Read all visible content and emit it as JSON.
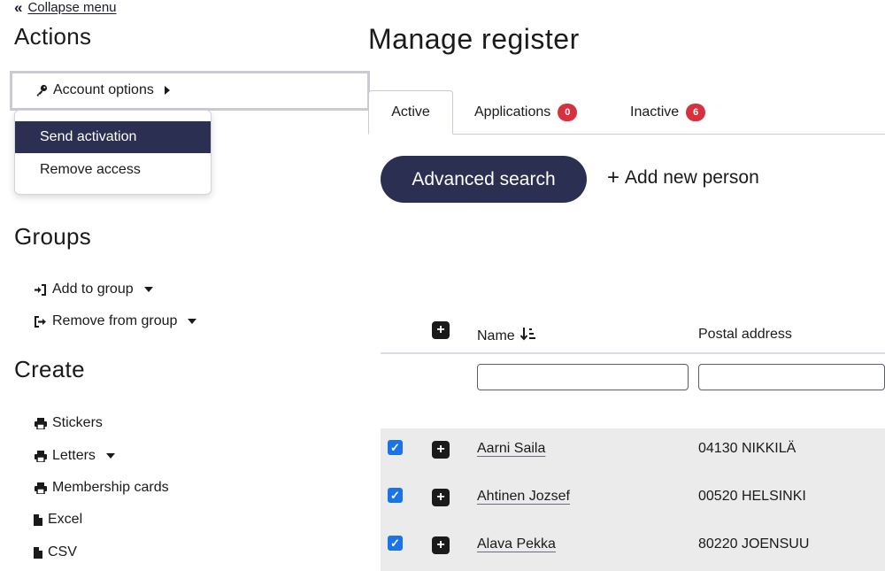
{
  "sidebar": {
    "collapse_label": "Collapse menu",
    "actions_heading": "Actions",
    "account_options_label": "Account options",
    "dropdown_items": [
      "Send activation",
      "Remove access"
    ],
    "groups_heading": "Groups",
    "groups_links": [
      "Add to group",
      "Remove from group"
    ],
    "create_heading": "Create",
    "create_links": [
      "Stickers",
      "Letters",
      "Membership cards",
      "Excel",
      "CSV"
    ]
  },
  "main": {
    "title": "Manage register",
    "tabs": [
      {
        "label": "Active",
        "count": ""
      },
      {
        "label": "Applications",
        "count": "0"
      },
      {
        "label": "Inactive",
        "count": "6"
      }
    ],
    "advanced_search_label": "Advanced search",
    "add_person_label": "Add new person",
    "columns": [
      "Name",
      "Postal address"
    ],
    "rows": [
      {
        "name": "Aarni Saila",
        "address": "04130 NIKKILÄ",
        "checked": true
      },
      {
        "name": "Ahtinen Jozsef",
        "address": "00520 HELSINKI",
        "checked": true
      },
      {
        "name": "Alava Pekka",
        "address": "80220 JOENSUU",
        "checked": true
      }
    ]
  },
  "colors": {
    "primary": "#2b2f52",
    "badge": "#d7303f",
    "checkbox": "#1a73e8",
    "row_bg": "#ebebeb"
  },
  "icons": [
    "double-chevron-left-icon",
    "key-icon",
    "caret-right-icon",
    "sign-in-icon",
    "sign-out-icon",
    "caret-down-icon",
    "print-icon",
    "file-icon",
    "plus-square-icon",
    "sort-down-icon",
    "checkbox-checked-icon"
  ]
}
